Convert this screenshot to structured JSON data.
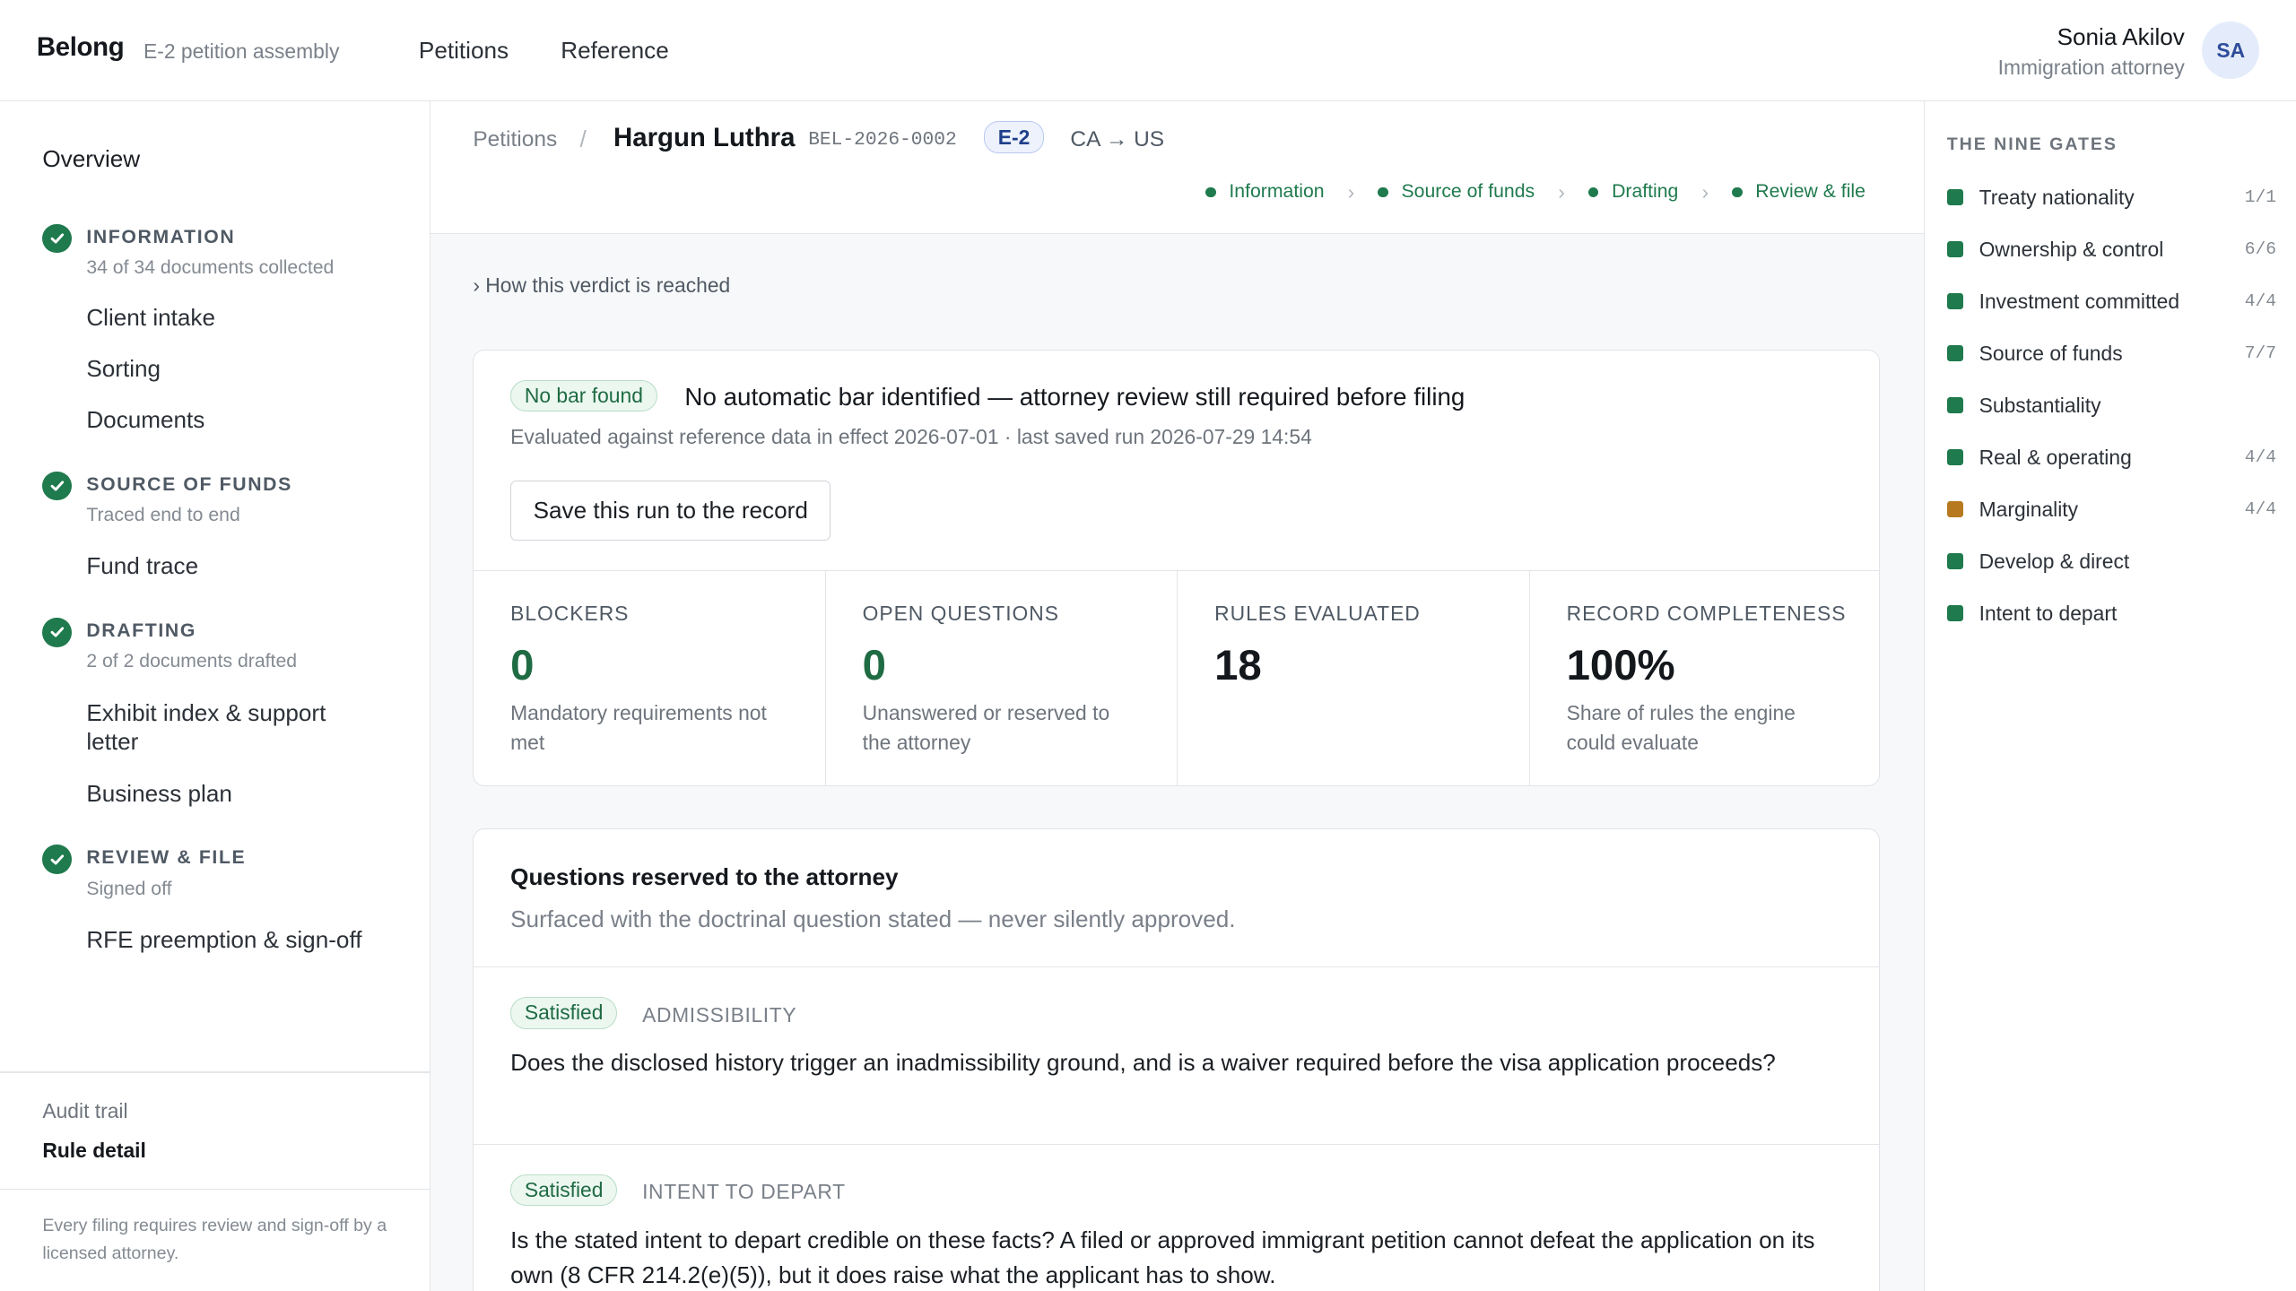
{
  "header": {
    "brand": "Belong",
    "brand_sub": "E-2 petition assembly",
    "nav": [
      "Petitions",
      "Reference"
    ],
    "user_name": "Sonia Akilov",
    "user_role": "Immigration attorney",
    "avatar_initials": "SA"
  },
  "sidebar": {
    "overview": "Overview",
    "sections": [
      {
        "title": "Information",
        "sub": "34 of 34 documents collected",
        "items": [
          "Client intake",
          "Sorting",
          "Documents"
        ]
      },
      {
        "title": "Source of funds",
        "sub": "Traced end to end",
        "items": [
          "Fund trace"
        ]
      },
      {
        "title": "Drafting",
        "sub": "2 of 2 documents drafted",
        "items": [
          "Exhibit index & support letter",
          "Business plan"
        ]
      },
      {
        "title": "Review & file",
        "sub": "Signed off",
        "items": [
          "RFE preemption & sign-off"
        ]
      }
    ],
    "audit_trail": "Audit trail",
    "rule_detail": "Rule detail",
    "footer": "Every filing requires review and sign-off by a licensed attorney."
  },
  "breadcrumb": {
    "parent": "Petitions",
    "separator": "/",
    "client": "Hargun Luthra",
    "case_id": "BEL-2026-0002",
    "visa": "E-2",
    "route": "CA → US"
  },
  "steps": [
    "Information",
    "Source of funds",
    "Drafting",
    "Review & file"
  ],
  "verdict_toggle": "› How this verdict is reached",
  "verdict": {
    "badge": "No bar found",
    "title": "No automatic bar identified — attorney review still required before filing",
    "meta": "Evaluated against reference data in effect 2026-07-01 · last saved run 2026-07-29 14:54",
    "save_button": "Save this run to the record"
  },
  "stats": [
    {
      "label": "Blockers",
      "value": "0",
      "desc": "Mandatory requirements not met"
    },
    {
      "label": "Open questions",
      "value": "0",
      "desc": "Unanswered or reserved to the attorney"
    },
    {
      "label": "Rules evaluated",
      "value": "18",
      "desc": ""
    },
    {
      "label": "Record completeness",
      "value": "100%",
      "desc": "Share of rules the engine could evaluate"
    }
  ],
  "questions": {
    "title": "Questions reserved to the attorney",
    "subtitle": "Surfaced with the doctrinal question stated — never silently approved.",
    "items": [
      {
        "status": "Satisfied",
        "category": "Admissibility",
        "text": "Does the disclosed history trigger an inadmissibility ground, and is a waiver required before the visa application proceeds?"
      },
      {
        "status": "Satisfied",
        "category": "Intent to depart",
        "text": "Is the stated intent to depart credible on these facts? A filed or approved immigrant petition cannot defeat the application on its own (8 CFR 214.2(e)(5)), but it does raise what the applicant has to show."
      }
    ]
  },
  "gates": {
    "title": "The nine gates",
    "items": [
      {
        "name": "Treaty nationality",
        "count": "1/1",
        "color": "#1f7a4d"
      },
      {
        "name": "Ownership & control",
        "count": "6/6",
        "color": "#1f7a4d"
      },
      {
        "name": "Investment committed",
        "count": "4/4",
        "color": "#1f7a4d"
      },
      {
        "name": "Source of funds",
        "count": "7/7",
        "color": "#1f7a4d"
      },
      {
        "name": "Substantiality",
        "count": "",
        "color": "#1f7a4d"
      },
      {
        "name": "Real & operating",
        "count": "4/4",
        "color": "#1f7a4d"
      },
      {
        "name": "Marginality",
        "count": "4/4",
        "color": "#b7791f"
      },
      {
        "name": "Develop & direct",
        "count": "",
        "color": "#1f7a4d"
      },
      {
        "name": "Intent to depart",
        "count": "",
        "color": "#1f7a4d"
      }
    ]
  }
}
